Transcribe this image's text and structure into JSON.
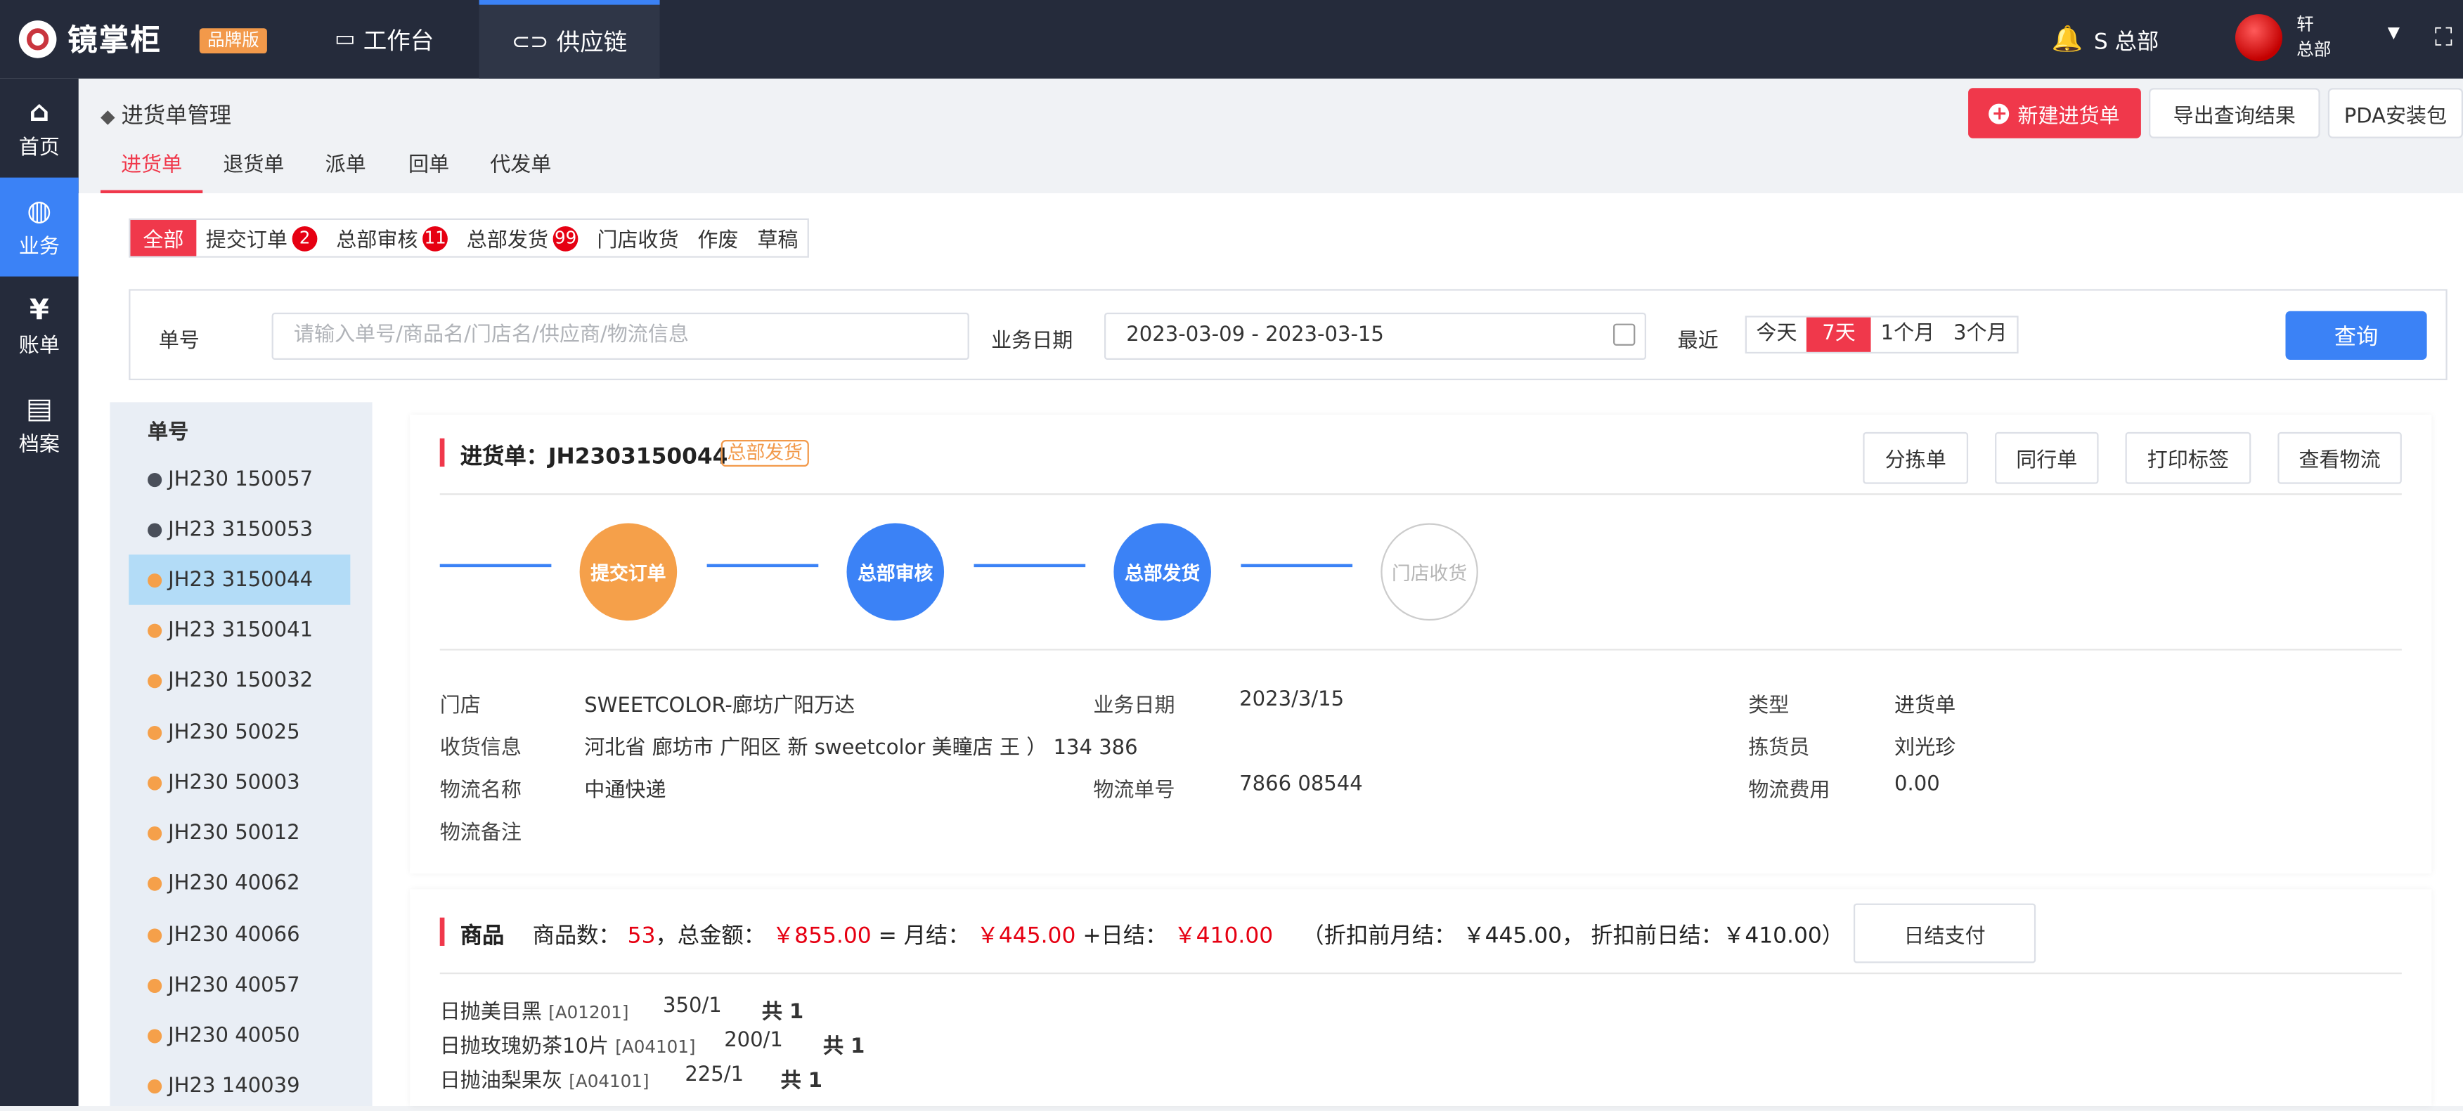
{
  "topbar": {
    "logo_text": "镜掌柜",
    "brand_badge": "品牌版",
    "nav_workbench": "工作台",
    "nav_supply": "供应链",
    "hq_label": "S 总部",
    "user_line1": "轩 ",
    "user_line2": "总部"
  },
  "sidebar": {
    "items": [
      {
        "label": "首页",
        "icon": "home-icon"
      },
      {
        "label": "业务",
        "icon": "globe-icon"
      },
      {
        "label": "账单",
        "icon": "yen-icon"
      },
      {
        "label": "档案",
        "icon": "file-icon"
      }
    ]
  },
  "page": {
    "breadcrumb": "进货单管理",
    "new_button": "新建进货单",
    "export_button": "导出查询结果",
    "pda_button": "PDA安装包",
    "tabs": [
      "进货单",
      "退货单",
      "派单",
      "回单",
      "代发单"
    ]
  },
  "status_filter": {
    "items": [
      {
        "label": "全部",
        "badge": ""
      },
      {
        "label": "提交订单",
        "badge": "2"
      },
      {
        "label": "总部审核",
        "badge": "11"
      },
      {
        "label": "总部发货",
        "badge": "99"
      },
      {
        "label": "门店收货",
        "badge": ""
      },
      {
        "label": "作废",
        "badge": ""
      },
      {
        "label": "草稿",
        "badge": ""
      }
    ]
  },
  "search": {
    "order_label": "单号",
    "order_placeholder": "请输入单号/商品名/门店名/供应商/物流信息",
    "date_label": "业务日期",
    "date_value": "2023-03-09 - 2023-03-15",
    "recent_label": "最近",
    "ranges": [
      "今天",
      "7天",
      "1个月",
      "3个月"
    ],
    "query_button": "查询"
  },
  "order_list": {
    "header": "单号",
    "items": [
      "JH230 150057",
      "JH23 3150053",
      "JH23 3150044",
      "JH23 3150041",
      "JH230 150032",
      "JH230 50025",
      "JH230 50003",
      "JH230 50012",
      "JH230 40062",
      "JH230 40066",
      "JH230 40057",
      "JH230 40050",
      "JH23 140039"
    ]
  },
  "detail": {
    "title_prefix": "进货单：",
    "order_no": "JH2303150044",
    "status_tag": "总部发货",
    "actions": [
      "分拣单",
      "同行单",
      "打印标签",
      "查看物流"
    ],
    "steps": [
      "提交订单",
      "总部审核",
      "总部发货",
      "门店收货"
    ],
    "info": {
      "store_label": "门店",
      "store_value": "SWEETCOLOR-廊坊广阳万达",
      "biz_date_label": "业务日期",
      "biz_date_value": "2023/3/15",
      "type_label": "类型",
      "type_value": "进货单",
      "receiver_label": "收货信息",
      "receiver_value": "河北省 廊坊市 广阳区 新 sweetcolor 美瞳店 王 ） 134 386",
      "picker_label": "拣货员",
      "picker_value": "刘光珍",
      "logistics_name_label": "物流名称",
      "logistics_name_value": "中通快递",
      "logistics_no_label": "物流单号",
      "logistics_no_value": "7866 08544",
      "logistics_fee_label": "物流费用",
      "logistics_fee_value": "0.00",
      "logistics_note_label": "物流备注"
    }
  },
  "goods": {
    "title": "商品",
    "count_label": "商品数：",
    "count": "53",
    "total_label": "，总金额：",
    "total": "￥855.00",
    "monthly_label": "= 月结：",
    "monthly": "￥445.00",
    "daily_label": "+日结：",
    "daily": "￥410.00",
    "pre_discount": "（折扣前月结：  ￥445.00， 折扣前日结：￥410.00）",
    "pay_button": "日结支付",
    "rows": [
      {
        "name": "日抛美目黑",
        "code": "[A01201]",
        "qty": "350/1",
        "total": "共 1"
      },
      {
        "name": "日抛玫瑰奶茶10片",
        "code": "[A04101]",
        "qty": "200/1",
        "total": "共 1"
      },
      {
        "name": "日抛油梨果灰",
        "code": "[A04101]",
        "qty": "225/1",
        "total": "共 1"
      }
    ]
  },
  "colors": {
    "accent_red": "#f0384b",
    "accent_blue": "#3b82f6",
    "topbar_bg": "#252b3b",
    "step_orange": "#f5a04a"
  }
}
